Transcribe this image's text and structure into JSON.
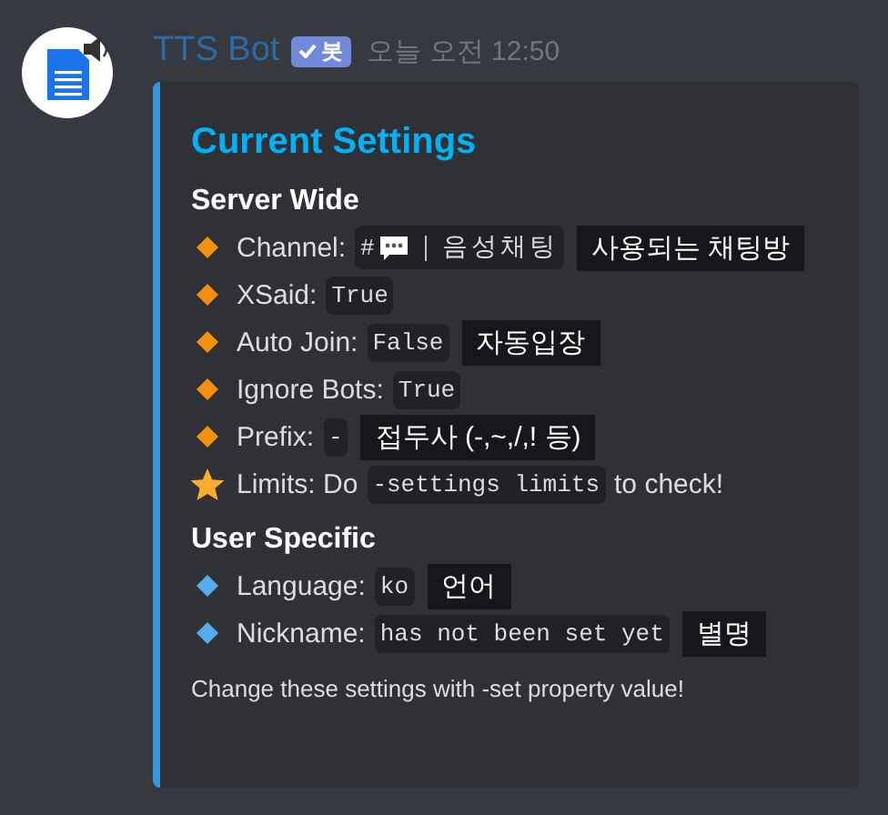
{
  "message": {
    "author": "TTS Bot",
    "badge": "봇",
    "badge_verified": true,
    "timestamp": "오늘 오전 12:50"
  },
  "embed": {
    "title": "Current Settings",
    "sections": [
      {
        "heading": "Server Wide",
        "rows": [
          {
            "kind": "orange-diamond",
            "segments": [
              {
                "kind": "text",
                "text": "Channel:"
              },
              {
                "kind": "code",
                "prefix": "#",
                "icon": true,
                "text": "｜음성채팅"
              },
              {
                "kind": "note",
                "text": "사용되는 채팅방"
              }
            ]
          },
          {
            "kind": "orange-diamond",
            "segments": [
              {
                "kind": "text",
                "text": "XSaid:"
              },
              {
                "kind": "code",
                "text": "True"
              }
            ]
          },
          {
            "kind": "orange-diamond",
            "segments": [
              {
                "kind": "text",
                "text": "Auto Join:"
              },
              {
                "kind": "code",
                "text": "False"
              },
              {
                "kind": "note",
                "text": "자동입장"
              }
            ]
          },
          {
            "kind": "orange-diamond",
            "segments": [
              {
                "kind": "text",
                "text": "Ignore Bots:"
              },
              {
                "kind": "code",
                "text": "True"
              }
            ]
          },
          {
            "kind": "orange-diamond",
            "segments": [
              {
                "kind": "text",
                "text": "Prefix:"
              },
              {
                "kind": "code",
                "text": "-"
              },
              {
                "kind": "note",
                "text": "접두사 (-,~,/,! 등)"
              }
            ]
          },
          {
            "kind": "star",
            "segments": [
              {
                "kind": "text",
                "text": "Limits: Do"
              },
              {
                "kind": "code",
                "text": "-settings limits"
              },
              {
                "kind": "text",
                "text": "to check!"
              }
            ]
          }
        ]
      },
      {
        "heading": "User Specific",
        "rows": [
          {
            "kind": "blue-diamond",
            "segments": [
              {
                "kind": "text",
                "text": "Language:"
              },
              {
                "kind": "code",
                "text": "ko"
              },
              {
                "kind": "note",
                "text": "언어"
              }
            ]
          },
          {
            "kind": "blue-diamond",
            "segments": [
              {
                "kind": "text",
                "text": "Nickname:"
              },
              {
                "kind": "code",
                "text": "has not been set yet"
              },
              {
                "kind": "note",
                "text": "별명"
              }
            ]
          }
        ]
      }
    ],
    "footer": "Change these settings with -set property value!"
  }
}
